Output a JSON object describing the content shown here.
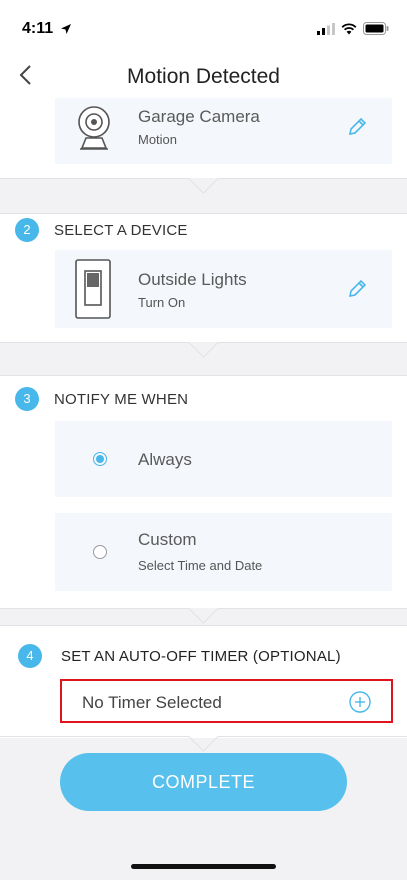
{
  "status_bar": {
    "time": "4:11"
  },
  "nav": {
    "title": "Motion Detected"
  },
  "trigger": {
    "title": "Garage Camera",
    "subtitle": "Motion"
  },
  "step2": {
    "number": "2",
    "title": "SELECT A DEVICE",
    "device_title": "Outside Lights",
    "device_subtitle": "Turn On"
  },
  "step3": {
    "number": "3",
    "title": "NOTIFY ME WHEN",
    "options": [
      {
        "label": "Always",
        "selected": true
      },
      {
        "label": "Custom",
        "subtitle": "Select Time and Date",
        "selected": false
      }
    ]
  },
  "step4": {
    "number": "4",
    "title": "SET AN AUTO-OFF TIMER (OPTIONAL)",
    "timer_value": "No Timer Selected"
  },
  "complete_label": "COMPLETE",
  "colors": {
    "accent": "#48b8ea",
    "button": "#58c0ec",
    "highlight": "#e0141c",
    "card": "#f4f7fb"
  }
}
